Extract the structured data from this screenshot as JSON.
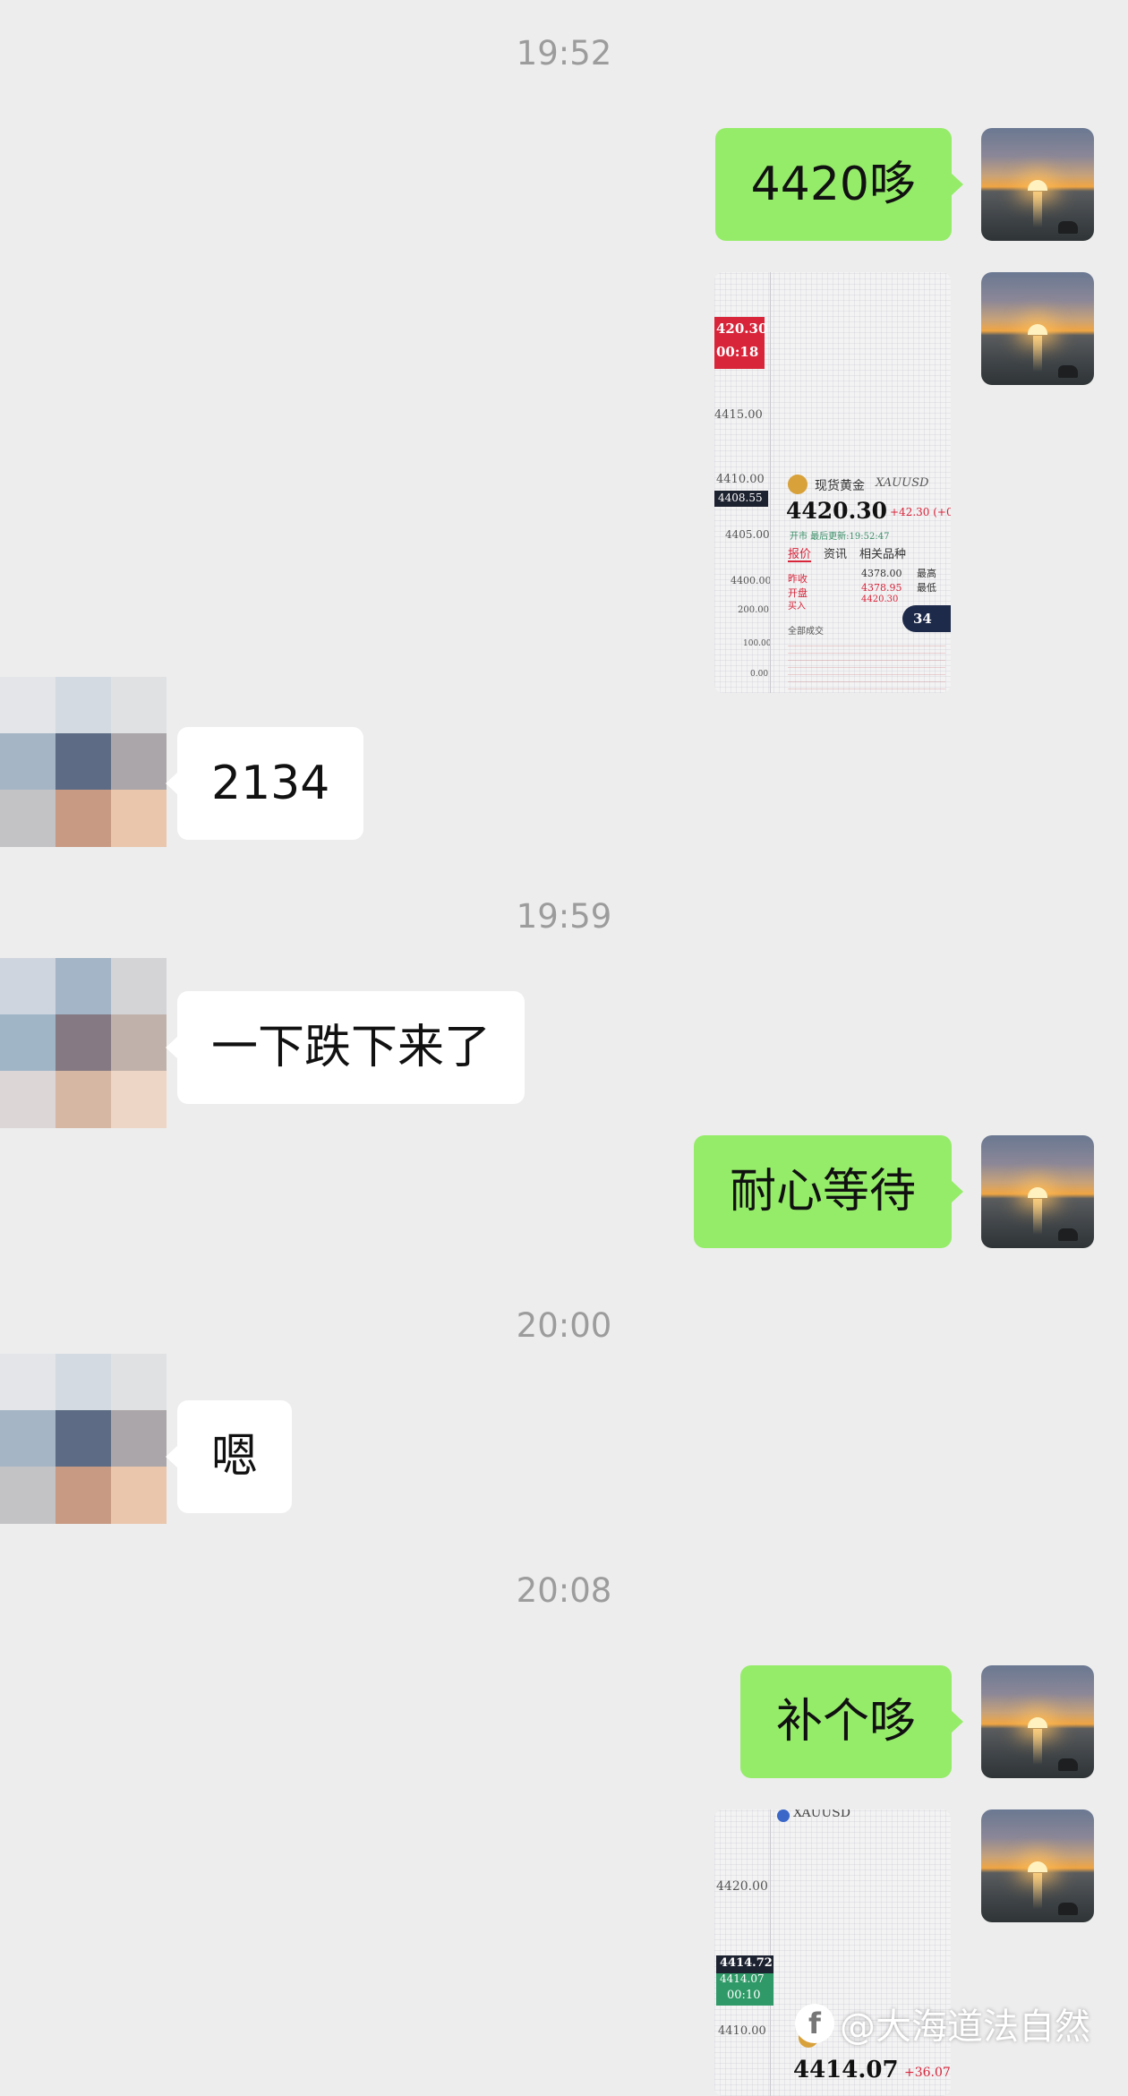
{
  "timestamps": [
    "19:52",
    "19:59",
    "20:00",
    "20:08"
  ],
  "messages": {
    "m1": "4420哆",
    "m2": "2134",
    "m3": "一下跌下来了",
    "m4": "耐心等待",
    "m5": "嗯",
    "m6": "补个哆"
  },
  "image1": {
    "top_price": "420.30",
    "top_time": "00:18",
    "axis_4415": "4415.00",
    "axis_4410": "4410.00",
    "axis_tag": "4408.55",
    "axis_4405": "4405.00",
    "axis_4400": "4400.00",
    "axis_200": "200.00",
    "axis_100": "100.00",
    "axis_0": "0.00",
    "product_cn": "现货黄金",
    "product_code": "XAUUSD",
    "price": "4420.30",
    "change": "+42.30 (+0.9",
    "status": "开市 最后更新:19:52:47",
    "tab_quote": "报价",
    "tab_news": "资讯",
    "tab_related": "相关品种",
    "row1_label": "昨收",
    "row1_val": "4378.00",
    "row1_col": "最高",
    "row2_label": "开盘",
    "row2_val": "4378.95",
    "row2_col": "最低",
    "row3_label": "买入",
    "row3_val": "4420.30",
    "list_header": "全部成交",
    "badge": "34"
  },
  "image2": {
    "code": "XAUUSD",
    "axis_4420": "4420.00",
    "tag_price": "4414.72",
    "tag_price2": "4414.07",
    "tag_time": "00:10",
    "axis_4410": "4410.00",
    "price": "4414.07",
    "change": "+36.07"
  },
  "watermark": {
    "logo": "f",
    "text": "@大海道法自然"
  },
  "colors": {
    "background": "#ededed",
    "my_bubble": "#95ec69",
    "other_bubble": "#ffffff",
    "timestamp": "#9c9c9c"
  }
}
